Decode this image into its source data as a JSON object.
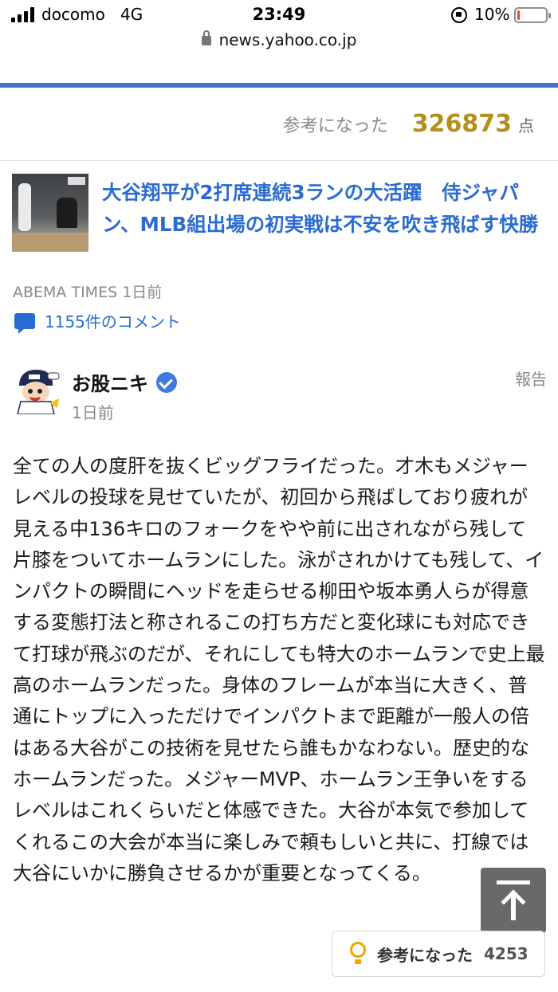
{
  "status_bar": {
    "carrier": "docomo",
    "network": "4G",
    "time": "23:49",
    "battery_percent": "10%",
    "battery_level": 0.1,
    "battery_color": "#ff3b30"
  },
  "browser": {
    "url": "news.yahoo.co.jp"
  },
  "article_summary": {
    "helpful_label": "参考になった",
    "helpful_count": "326873",
    "helpful_unit": "点"
  },
  "article": {
    "title": "大谷翔平が2打席連続3ランの大活躍　侍ジャパン、MLB組出場の初実戦は不安を吹き飛ばす快勝",
    "source": "ABEMA TIMES",
    "posted": "1日前",
    "comments_link": "1155件のコメント",
    "thumbnail_icon": "baseball-photo"
  },
  "comment": {
    "user_name": "お股ニキ",
    "verified_icon": "verified-badge-icon",
    "timestamp": "1日前",
    "report_label": "報告",
    "body": "全ての人の度肝を抜くビッグフライだった。才木もメジャーレベルの投球を見せていたが、初回から飛ばしており疲れが見える中136キロのフォークをやや前に出されながら残して片膝をついてホームランにした。泳がされかけても残して、インパクトの瞬間にヘッドを走らせる柳田や坂本勇人らが得意する変態打法と称されるこの打ち方だと変化球にも対応できて打球が飛ぶのだが、それにしても特大のホームランで史上最高のホームランだった。身体のフレームが本当に大きく、普通にトップに入っただけでインパクトまで距離が一般人の倍はある大谷がこの技術を見せたら誰もかなわない。歴史的なホームランだった。メジャーMVP、ホームラン王争いをするレベルはこれくらいだと体感できた。大谷が本気で参加してくれるこの大会が本当に楽しみで頼もしいと共に、打線では大谷にいかに勝負させるかが重要となってくる。",
    "helpful_button_label": "参考になった",
    "helpful_button_count": "4253"
  },
  "colors": {
    "accent_blue": "#2a6bd1",
    "helpful_gold": "#b58f1d",
    "bulb_orange": "#f0a500"
  }
}
